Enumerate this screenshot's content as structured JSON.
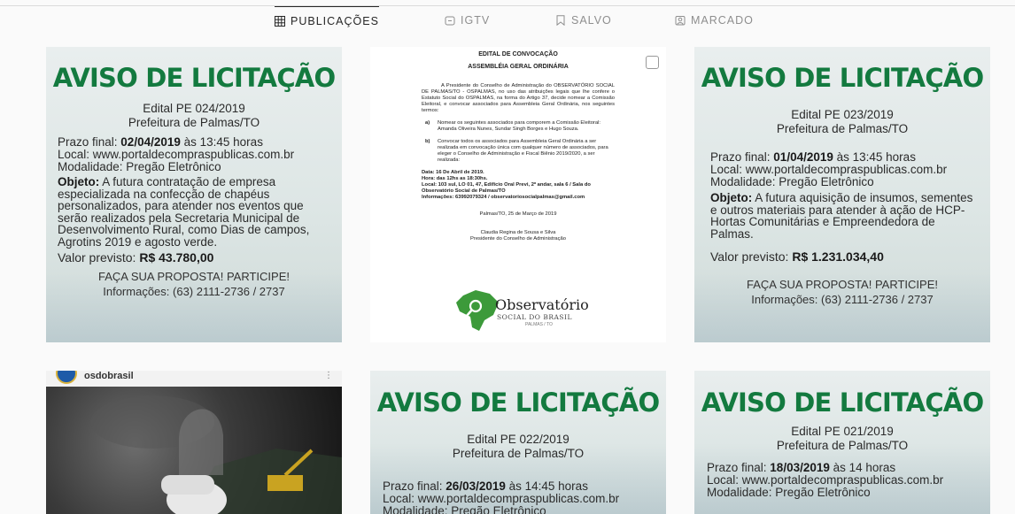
{
  "tabs": [
    {
      "label": "PUBLICAÇÕES",
      "icon": "grid-icon",
      "active": true
    },
    {
      "label": "IGTV",
      "icon": "igtv-icon",
      "active": false
    },
    {
      "label": "SALVO",
      "icon": "bookmark-icon",
      "active": false
    },
    {
      "label": "MARCADO",
      "icon": "tagged-icon",
      "active": false
    }
  ],
  "colors": {
    "aviso_green": "#137a3f",
    "active_tab": "#262626",
    "inactive_tab": "#8e8e8e"
  },
  "post1": {
    "title": "AVISO DE LICITAÇÃO",
    "edital": "Edital PE 024/2019",
    "prefeitura": "Prefeitura de Palmas/TO",
    "prazo_label": "Prazo final: ",
    "prazo_date": "02/04/2019",
    "prazo_time": " às 13:45 horas",
    "local": "Local: www.portaldecompraspublicas.com.br",
    "modalidade": "Modalidade: Pregão Eletrônico",
    "objeto_label": "Objeto:",
    "objeto_text": " A futura contratação de empresa especializada na confecção de chapéus personalizados, para atender nos eventos que serão realizados pela Secretaria Municipal de Desenvolvimento Rural, como Dias de campos, Agrotins 2019 e agosto verde.",
    "valor_label": "Valor previsto: ",
    "valor": "R$ 43.780,00",
    "cta": "FAÇA SUA PROPOSTA! PARTICIPE!",
    "info": "Informações: (63) 2111-2736 / 2737"
  },
  "post2": {
    "title1": "EDITAL DE CONVOCAÇÃO",
    "title2": "ASSEMBLÉIA GERAL ORDINÁRIA",
    "intro": "A Presidente do Conselho de Administração do OBSERVATÓRIO SOCIAL DE PALMAS/TO - OSPALMAS, no uso das atribuições legais que lhe confere o Estatuto Social do OSPALMAS, na forma do Artigo 37, decide nomear a Comissão Eleitoral, e convocar associados para Assembleia Geral Ordinária, nos seguintes termos:",
    "item_a_label": "a)",
    "item_a": "Nomear os seguintes associados para comporem a Comissão Eleitoral: Amanda Oliveira Nunes, Sundar Singh Borges e Hugo Souza.",
    "item_b_label": "b)",
    "item_b": "Convocar todos os associados para Assembleia Geral Ordinária a ser realizada em convocação única com qualquer número de associados, para eleger o Conselho de Administração e Fiscal Biênio 2019/2020, a ser realizada:",
    "meeting_lines": [
      "Data: 16 De Abril de 2019.",
      "Hora: das 12hs as 18:30hs.",
      "Local: 103 sul, LO 01, 47, Edifício Oral Previ, 2º andar, sala 6 / Sala do Observatório Social de Palmas/TO",
      "Informações: 63992079324 / observatoriosocialpalmas@gmail.com"
    ],
    "place_date": "Palmas/TO, 25 de Março de 2019",
    "signer": "Claudia Regina de Sousa e Silva",
    "signer_role": "Presidente do Conselho de Administração",
    "logo_text": "Observatório",
    "logo_sub": "SOCIAL DO BRASIL",
    "logo_city": "PALMAS / TO"
  },
  "post3": {
    "title": "AVISO DE LICITAÇÃO",
    "edital": "Edital PE 023/2019",
    "prefeitura": "Prefeitura de Palmas/TO",
    "prazo_label": "Prazo final: ",
    "prazo_date": "01/04/2019",
    "prazo_time": " às 13:45 horas",
    "local": "Local: www.portaldecompraspublicas.com.br",
    "modalidade": "Modalidade: Pregão Eletrônico",
    "objeto_label": "Objeto:",
    "objeto_text": " A futura aquisição de insumos, sementes e outros materiais para atender à ação de HCP-Hortas Comunitárias e Empreendedora de Palmas.",
    "valor_label": "Valor previsto: ",
    "valor": "R$ 1.231.034,40",
    "cta": "FAÇA SUA PROPOSTA! PARTICIPE!",
    "info": "Informações: (63) 2111-2736 / 2737"
  },
  "post4": {
    "username": "osdobrasil",
    "menu_icon": "more-options-icon"
  },
  "post5": {
    "title": "AVISO DE LICITAÇÃO",
    "edital": "Edital PE 022/2019",
    "prefeitura": "Prefeitura de Palmas/TO",
    "prazo_label": "Prazo final: ",
    "prazo_date": "26/03/2019",
    "prazo_time": " às 14:45 horas",
    "local": "Local: www.portaldecompraspublicas.com.br",
    "modalidade": "Modalidade: Pregão Eletrônico"
  },
  "post6": {
    "title": "AVISO DE LICITAÇÃO",
    "edital": "Edital PE 021/2019",
    "prefeitura": "Prefeitura de Palmas/TO",
    "prazo_label": "Prazo final: ",
    "prazo_date": "18/03/2019",
    "prazo_time": " às 14 horas",
    "local": "Local: www.portaldecompraspublicas.com.br",
    "modalidade": "Modalidade: Pregão Eletrônico"
  }
}
